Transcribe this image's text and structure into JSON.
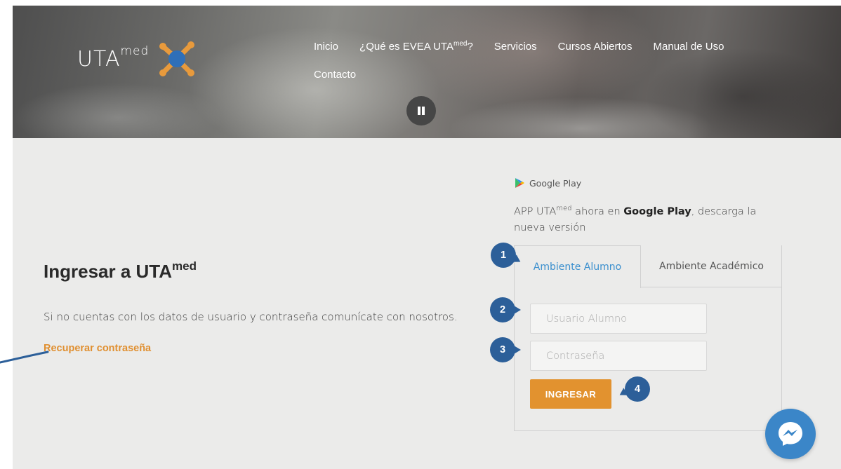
{
  "header": {
    "logo": {
      "text": "UTA",
      "sup": "med"
    },
    "nav_row1": [
      {
        "label": "Inicio"
      },
      {
        "label": "¿Qué es EVEA UTA",
        "sup": "med",
        "suffix": "?"
      },
      {
        "label": "Servicios"
      },
      {
        "label": "Cursos Abiertos"
      },
      {
        "label": "Manual de Uso"
      }
    ],
    "nav_row2": [
      {
        "label": "Contacto"
      }
    ],
    "pause_icon": "pause-icon"
  },
  "main": {
    "title": "Ingresar a UTA",
    "title_sup": "med",
    "subtitle": "Si no cuentas con los datos de usuario y contraseña comunícate con nosotros.",
    "recover_link": "Recuperar contraseña"
  },
  "app_promo": {
    "store_label": "Google Play",
    "text_pre": "APP UTA",
    "text_sup": "med",
    "text_mid": " ahora en ",
    "text_bold": "Google Play",
    "text_post": ", descarga la nueva versión"
  },
  "login": {
    "tabs": [
      {
        "label": "Ambiente Alumno",
        "active": true
      },
      {
        "label": "Ambiente Académico",
        "active": false
      }
    ],
    "username_placeholder": "Usuario Alumno",
    "username_value": "",
    "password_placeholder": "Contraseña",
    "password_value": "",
    "submit_label": "INGRESAR"
  },
  "callouts": [
    "1",
    "2",
    "3",
    "4"
  ],
  "colors": {
    "accent_orange": "#e2922f",
    "link_blue": "#3a8fce",
    "callout_blue": "#2c5f99",
    "messenger_blue": "#3b86c8",
    "logo_orange": "#e89a3c",
    "logo_blue": "#2f6fb8"
  }
}
